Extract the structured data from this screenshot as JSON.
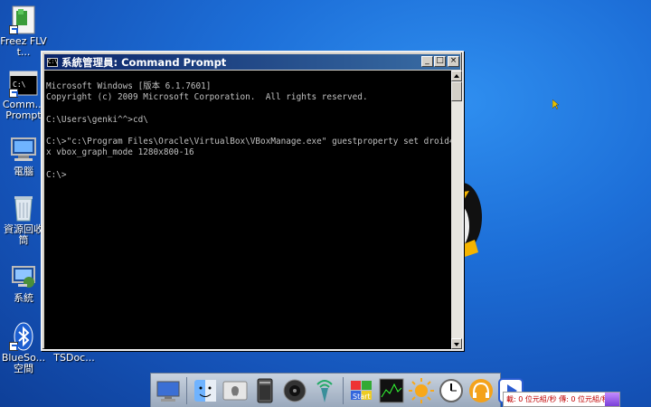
{
  "desktop": {
    "icons": [
      {
        "label": "Freez FLV t...",
        "icon": "freez-flv-icon"
      },
      {
        "label": "Comm... Prompt",
        "icon": "command-prompt-icon"
      },
      {
        "label": "電腦",
        "icon": "computer-icon"
      },
      {
        "label": "資源回收筒",
        "icon": "recycle-bin-icon"
      },
      {
        "label": "系統",
        "icon": "system-icon"
      },
      {
        "label": "BlueSo... 空間",
        "icon": "bluetooth-icon"
      },
      {
        "label": "TSDoc...",
        "icon": "tsdoc-icon"
      }
    ]
  },
  "window": {
    "title": "系統管理員: Command Prompt",
    "buttons": {
      "minimize": "_",
      "maximize": "□",
      "close": "×"
    },
    "console_lines": [
      "Microsoft Windows [版本 6.1.7601]",
      "Copyright (c) 2009 Microsoft Corporation.  All rights reserved.",
      "",
      "C:\\Users\\genki^^>cd\\",
      "",
      "C:\\>\"c:\\Program Files\\Oracle\\VirtualBox\\VBoxManage.exe\" guestproperty set droid4",
      "x vbox_graph_mode 1280x800-16",
      "",
      "C:\\>"
    ]
  },
  "dock": {
    "items": [
      "monitor-icon",
      "finder-icon",
      "apple-icon",
      "mac-pro-icon",
      "speaker-icon",
      "wireless-icon",
      "start-icon",
      "activity-monitor-icon",
      "sun-icon",
      "clock-icon",
      "headphones-icon",
      "media-player-icon"
    ]
  },
  "netmeter": {
    "text": "載: 0 位元組/秒 傳: 0 位元組/秒"
  },
  "colors": {
    "desktop": "#1d6fd8",
    "titlebar": "#0a246a",
    "console_bg": "#000000",
    "console_fg": "#c0c0c0"
  }
}
